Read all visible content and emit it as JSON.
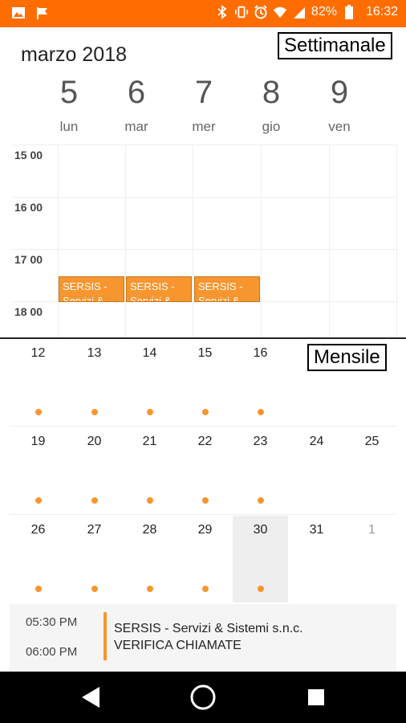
{
  "status_bar": {
    "battery": "82%",
    "time": "16:32",
    "left_icons": [
      "image-icon",
      "flag-icon"
    ],
    "right_icons": [
      "bluetooth-icon",
      "vibrate-icon",
      "alarm-icon",
      "wifi-icon",
      "signal-icon",
      "battery-icon"
    ]
  },
  "week_view": {
    "mode_label": "Settimanale",
    "month_title": "marzo 2018",
    "days": [
      {
        "num": "5",
        "name": "lun"
      },
      {
        "num": "6",
        "name": "mar"
      },
      {
        "num": "7",
        "name": "mer"
      },
      {
        "num": "8",
        "name": "gio"
      },
      {
        "num": "9",
        "name": "ven"
      }
    ],
    "hours": [
      "15 00",
      "16 00",
      "17 00",
      "18 00"
    ],
    "events": [
      {
        "line1": "SERSIS -",
        "line2": "Servizi &"
      },
      {
        "line1": "SERSIS -",
        "line2": "Servizi &"
      },
      {
        "line1": "SERSIS -",
        "line2": "Servizi &"
      }
    ]
  },
  "month_view": {
    "mode_label": "Mensile",
    "weeks": [
      [
        {
          "day": "12",
          "dot": true
        },
        {
          "day": "13",
          "dot": true
        },
        {
          "day": "14",
          "dot": true
        },
        {
          "day": "15",
          "dot": true
        },
        {
          "day": "16",
          "dot": true
        },
        {
          "day": "",
          "dot": false
        },
        {
          "day": "",
          "dot": false
        }
      ],
      [
        {
          "day": "19",
          "dot": true
        },
        {
          "day": "20",
          "dot": true
        },
        {
          "day": "21",
          "dot": true
        },
        {
          "day": "22",
          "dot": true
        },
        {
          "day": "23",
          "dot": true
        },
        {
          "day": "24",
          "dot": false
        },
        {
          "day": "25",
          "dot": false
        }
      ],
      [
        {
          "day": "26",
          "dot": true
        },
        {
          "day": "27",
          "dot": true
        },
        {
          "day": "28",
          "dot": true
        },
        {
          "day": "29",
          "dot": true
        },
        {
          "day": "30",
          "dot": true,
          "selected": true
        },
        {
          "day": "31",
          "dot": false
        },
        {
          "day": "1",
          "dot": false,
          "other": true
        }
      ]
    ]
  },
  "agenda": {
    "start_time": "05:30 PM",
    "end_time": "06:00 PM",
    "title": "SERSIS - Servizi & Sistemi s.n.c.",
    "subtitle": "VERIFICA CHIAMATE"
  },
  "colors": {
    "status_bar": "#ff6d00",
    "event": "#f7962f",
    "selected_day": "#eeeeee"
  }
}
